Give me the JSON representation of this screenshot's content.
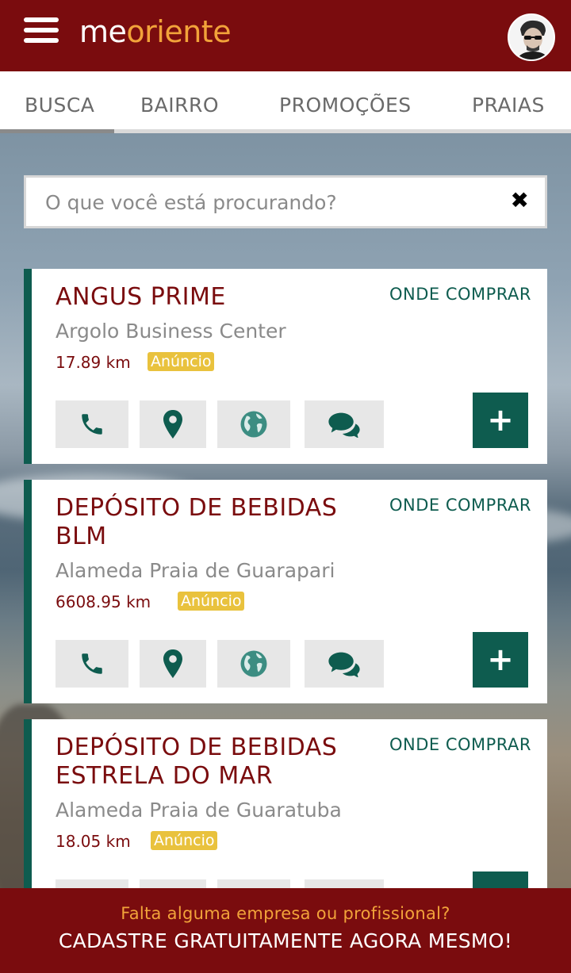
{
  "header": {
    "logo_me": "me",
    "logo_oriente": "oriente"
  },
  "tabs": [
    {
      "label": "BUSCA"
    },
    {
      "label": "BAIRRO"
    },
    {
      "label": "PROMOÇÕES"
    },
    {
      "label": "PRAIAS"
    }
  ],
  "search": {
    "placeholder": "O que você está procurando?",
    "value": "",
    "clear_label": "✖"
  },
  "results": [
    {
      "name_line1": "ANGUS PRIME",
      "name_line2": "",
      "where_label": "ONDE COMPRAR",
      "address": "Argolo Business Center",
      "distance": "17.89 km",
      "badge": "Anúncio"
    },
    {
      "name_line1": "DEPÓSITO DE BEBIDAS",
      "name_line2": "BLM",
      "where_label": "ONDE COMPRAR",
      "address": "Alameda Praia de Guarapari",
      "distance": "6608.95 km",
      "badge": "Anúncio"
    },
    {
      "name_line1": "DEPÓSITO DE BEBIDAS",
      "name_line2": "ESTRELA DO MAR",
      "where_label": "ONDE COMPRAR",
      "address": "Alameda Praia de Guaratuba",
      "distance": "18.05 km",
      "badge": "Anúncio"
    }
  ],
  "icons": {
    "phone": "phone-icon",
    "map": "map-pin-icon",
    "web": "globe-icon",
    "chat": "chat-icon",
    "more": "plus-icon"
  },
  "plus_label": "+",
  "footer": {
    "question": "Falta alguma empresa ou profissional?",
    "cta": "CADASTRE GRATUITAMENTE AGORA MESMO!"
  },
  "colors": {
    "brand_red": "#7a0c0e",
    "brand_orange": "#f2a33a",
    "accent_green": "#0e5c4f",
    "badge_yellow": "#e9c23d"
  }
}
